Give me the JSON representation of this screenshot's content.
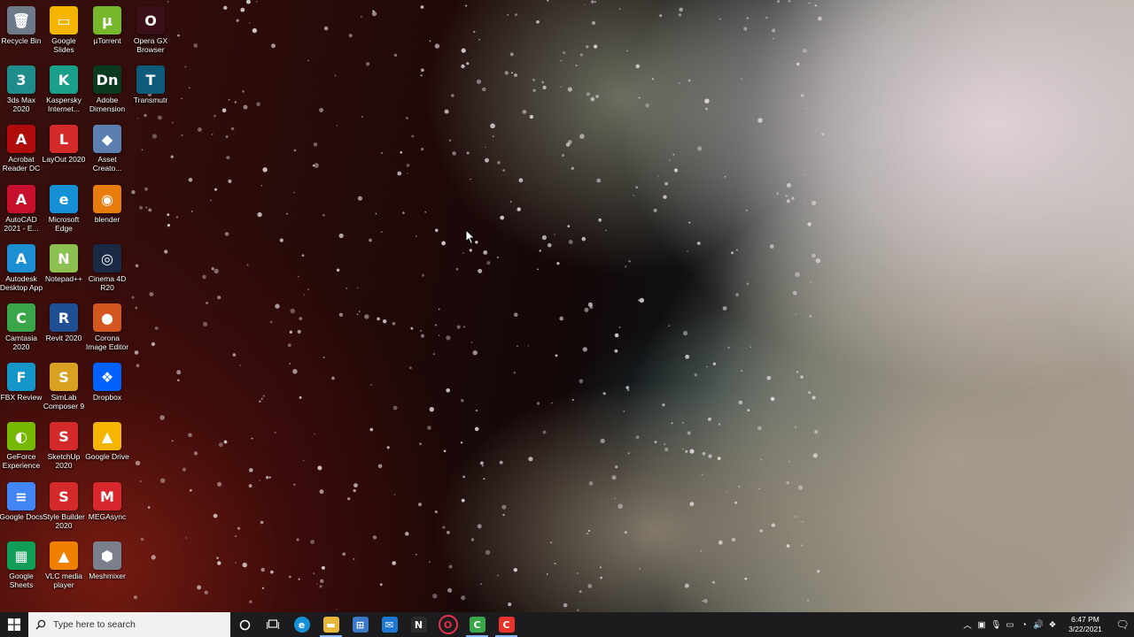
{
  "desktop_icons": [
    {
      "label": "Recycle Bin",
      "icon": "recycle-bin-icon",
      "color": "#6f7a88",
      "glyph": "🗑"
    },
    {
      "label": "Google Slides",
      "icon": "google-slides-icon",
      "color": "#f4b400",
      "glyph": "▭"
    },
    {
      "label": "µTorrent",
      "icon": "utorrent-icon",
      "color": "#76b82a",
      "glyph": "µ"
    },
    {
      "label": "Opera GX Browser",
      "icon": "opera-gx-icon",
      "color": "#3a0f18",
      "glyph": "O"
    },
    {
      "label": "3ds Max 2020",
      "icon": "3ds-max-icon",
      "color": "#1f8b8b",
      "glyph": "3"
    },
    {
      "label": "Kaspersky Internet...",
      "icon": "kaspersky-icon",
      "color": "#1aa08a",
      "glyph": "K"
    },
    {
      "label": "Adobe Dimension",
      "icon": "adobe-dimension-icon",
      "color": "#0b3a20",
      "glyph": "Dn"
    },
    {
      "label": "Transmutr",
      "icon": "transmutr-icon",
      "color": "#0e5a7a",
      "glyph": "T"
    },
    {
      "label": "Acrobat Reader DC",
      "icon": "acrobat-reader-icon",
      "color": "#b00c0c",
      "glyph": "A"
    },
    {
      "label": "LayOut 2020",
      "icon": "layout-icon",
      "color": "#d42a2a",
      "glyph": "L"
    },
    {
      "label": "Asset Creato...",
      "icon": "asset-creator-icon",
      "color": "#5a7fb0",
      "glyph": "◆"
    },
    {
      "label": "AutoCAD 2021 - E...",
      "icon": "autocad-icon",
      "color": "#c8102e",
      "glyph": "A"
    },
    {
      "label": "Microsoft Edge",
      "icon": "edge-icon",
      "color": "#1590d6",
      "glyph": "e"
    },
    {
      "label": "blender",
      "icon": "blender-icon",
      "color": "#e87d0d",
      "glyph": "◉"
    },
    {
      "label": "Autodesk Desktop App",
      "icon": "autodesk-app-icon",
      "color": "#1b8fd2",
      "glyph": "A"
    },
    {
      "label": "Notepad++",
      "icon": "notepad-plus-plus-icon",
      "color": "#8cc152",
      "glyph": "N"
    },
    {
      "label": "Cinema 4D R20",
      "icon": "cinema-4d-icon",
      "color": "#1a2a44",
      "glyph": "◎"
    },
    {
      "label": "Camtasia 2020",
      "icon": "camtasia-icon",
      "color": "#3aa64a",
      "glyph": "C"
    },
    {
      "label": "Revit 2020",
      "icon": "revit-icon",
      "color": "#1f4f93",
      "glyph": "R"
    },
    {
      "label": "Corona Image Editor",
      "icon": "corona-editor-icon",
      "color": "#d4561f",
      "glyph": "●"
    },
    {
      "label": "FBX Review",
      "icon": "fbx-review-icon",
      "color": "#1596c8",
      "glyph": "F"
    },
    {
      "label": "SimLab Composer 9",
      "icon": "simlab-composer-icon",
      "color": "#d9a021",
      "glyph": "S"
    },
    {
      "label": "Dropbox",
      "icon": "dropbox-icon",
      "color": "#0061fe",
      "glyph": "❖"
    },
    {
      "label": "GeForce Experience",
      "icon": "geforce-icon",
      "color": "#76b900",
      "glyph": "◐"
    },
    {
      "label": "SketchUp 2020",
      "icon": "sketchup-icon",
      "color": "#d42a2a",
      "glyph": "S"
    },
    {
      "label": "Google Drive",
      "icon": "google-drive-icon",
      "color": "#f4b400",
      "glyph": "▲"
    },
    {
      "label": "Google Docs",
      "icon": "google-docs-icon",
      "color": "#4285f4",
      "glyph": "≡"
    },
    {
      "label": "Style Builder 2020",
      "icon": "style-builder-icon",
      "color": "#d42a2a",
      "glyph": "S"
    },
    {
      "label": "MEGAsync",
      "icon": "megasync-icon",
      "color": "#d9272e",
      "glyph": "M"
    },
    {
      "label": "Google Sheets",
      "icon": "google-sheets-icon",
      "color": "#0f9d58",
      "glyph": "▦"
    },
    {
      "label": "VLC media player",
      "icon": "vlc-icon",
      "color": "#f08000",
      "glyph": "▲"
    },
    {
      "label": "Meshmixer",
      "icon": "meshmixer-icon",
      "color": "#7a7f8c",
      "glyph": "⬢"
    }
  ],
  "taskbar": {
    "search_placeholder": "Type here to search",
    "pinned": [
      {
        "name": "edge",
        "icon": "edge-icon",
        "color": "#1590d6",
        "glyph": "e",
        "active": false
      },
      {
        "name": "file-explorer",
        "icon": "folder-icon",
        "color": "#e8b73a",
        "glyph": "▬",
        "active": true
      },
      {
        "name": "microsoft-store",
        "icon": "store-icon",
        "color": "#3a78c8",
        "glyph": "⊞",
        "active": false
      },
      {
        "name": "mail",
        "icon": "mail-icon",
        "color": "#1f78d1",
        "glyph": "✉",
        "active": false
      },
      {
        "name": "app-n",
        "icon": "n-app-icon",
        "color": "#2b2b2b",
        "glyph": "N",
        "active": false
      },
      {
        "name": "opera-gx",
        "icon": "opera-gx-icon",
        "color": "#3a0f18",
        "glyph": "O",
        "active": false
      },
      {
        "name": "camtasia",
        "icon": "camtasia-icon",
        "color": "#3aa64a",
        "glyph": "C",
        "active": true
      },
      {
        "name": "camtasia-recorder",
        "icon": "camtasia-recorder-icon",
        "color": "#e8342a",
        "glyph": "C",
        "active": true
      }
    ],
    "clock_time": "6:47 PM",
    "clock_date": "3/22/2021"
  }
}
